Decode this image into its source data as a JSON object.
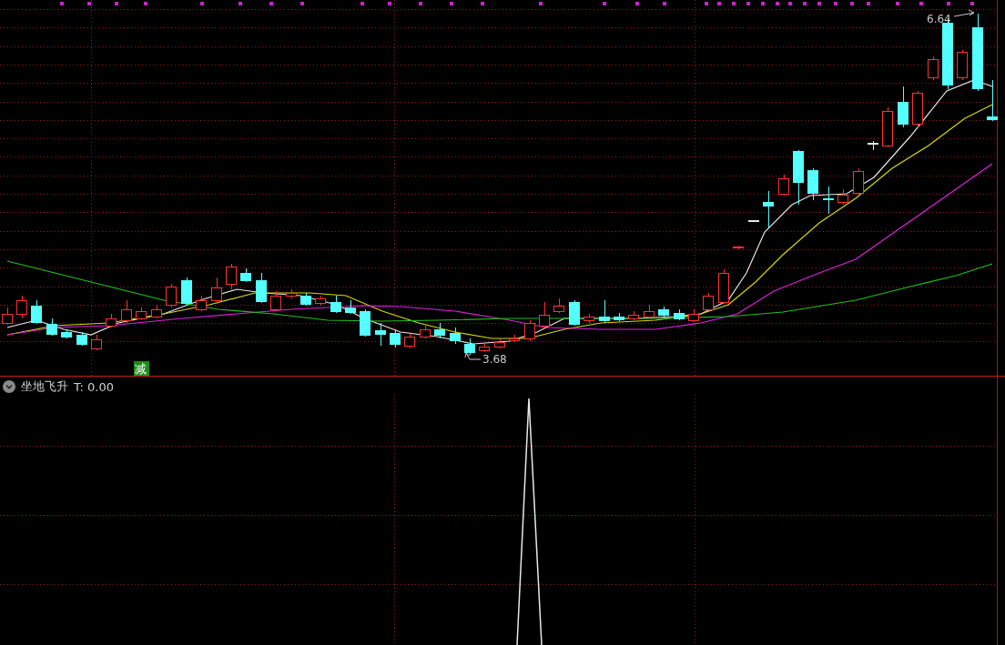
{
  "main_chart": {
    "high_label": "6.64",
    "low_label": "3.68",
    "signal_badge": "减"
  },
  "indicator_panel": {
    "name": "坐地飞升",
    "value": "T: 0.00"
  }
}
